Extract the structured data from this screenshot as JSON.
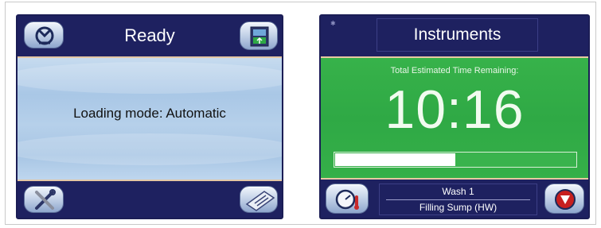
{
  "left_panel": {
    "title": "Ready",
    "message": "Loading mode: Automatic",
    "icons": {
      "top_left": "cycle-arrows-icon",
      "top_right": "unload-door-icon",
      "bottom_left": "tools-icon",
      "bottom_right": "clipboard-icon"
    }
  },
  "right_panel": {
    "title": "Instruments",
    "time_label": "Total Estimated Time Remaining:",
    "time_value": "10:16",
    "progress": 0.5,
    "status_line1": "Wash 1",
    "status_line2": "Filling Sump (HW)",
    "icons": {
      "bottom_left": "thermometer-gauge-icon",
      "bottom_right": "stop-icon"
    },
    "colors": {
      "green": "#2fa945",
      "navy": "#1e2160"
    }
  }
}
